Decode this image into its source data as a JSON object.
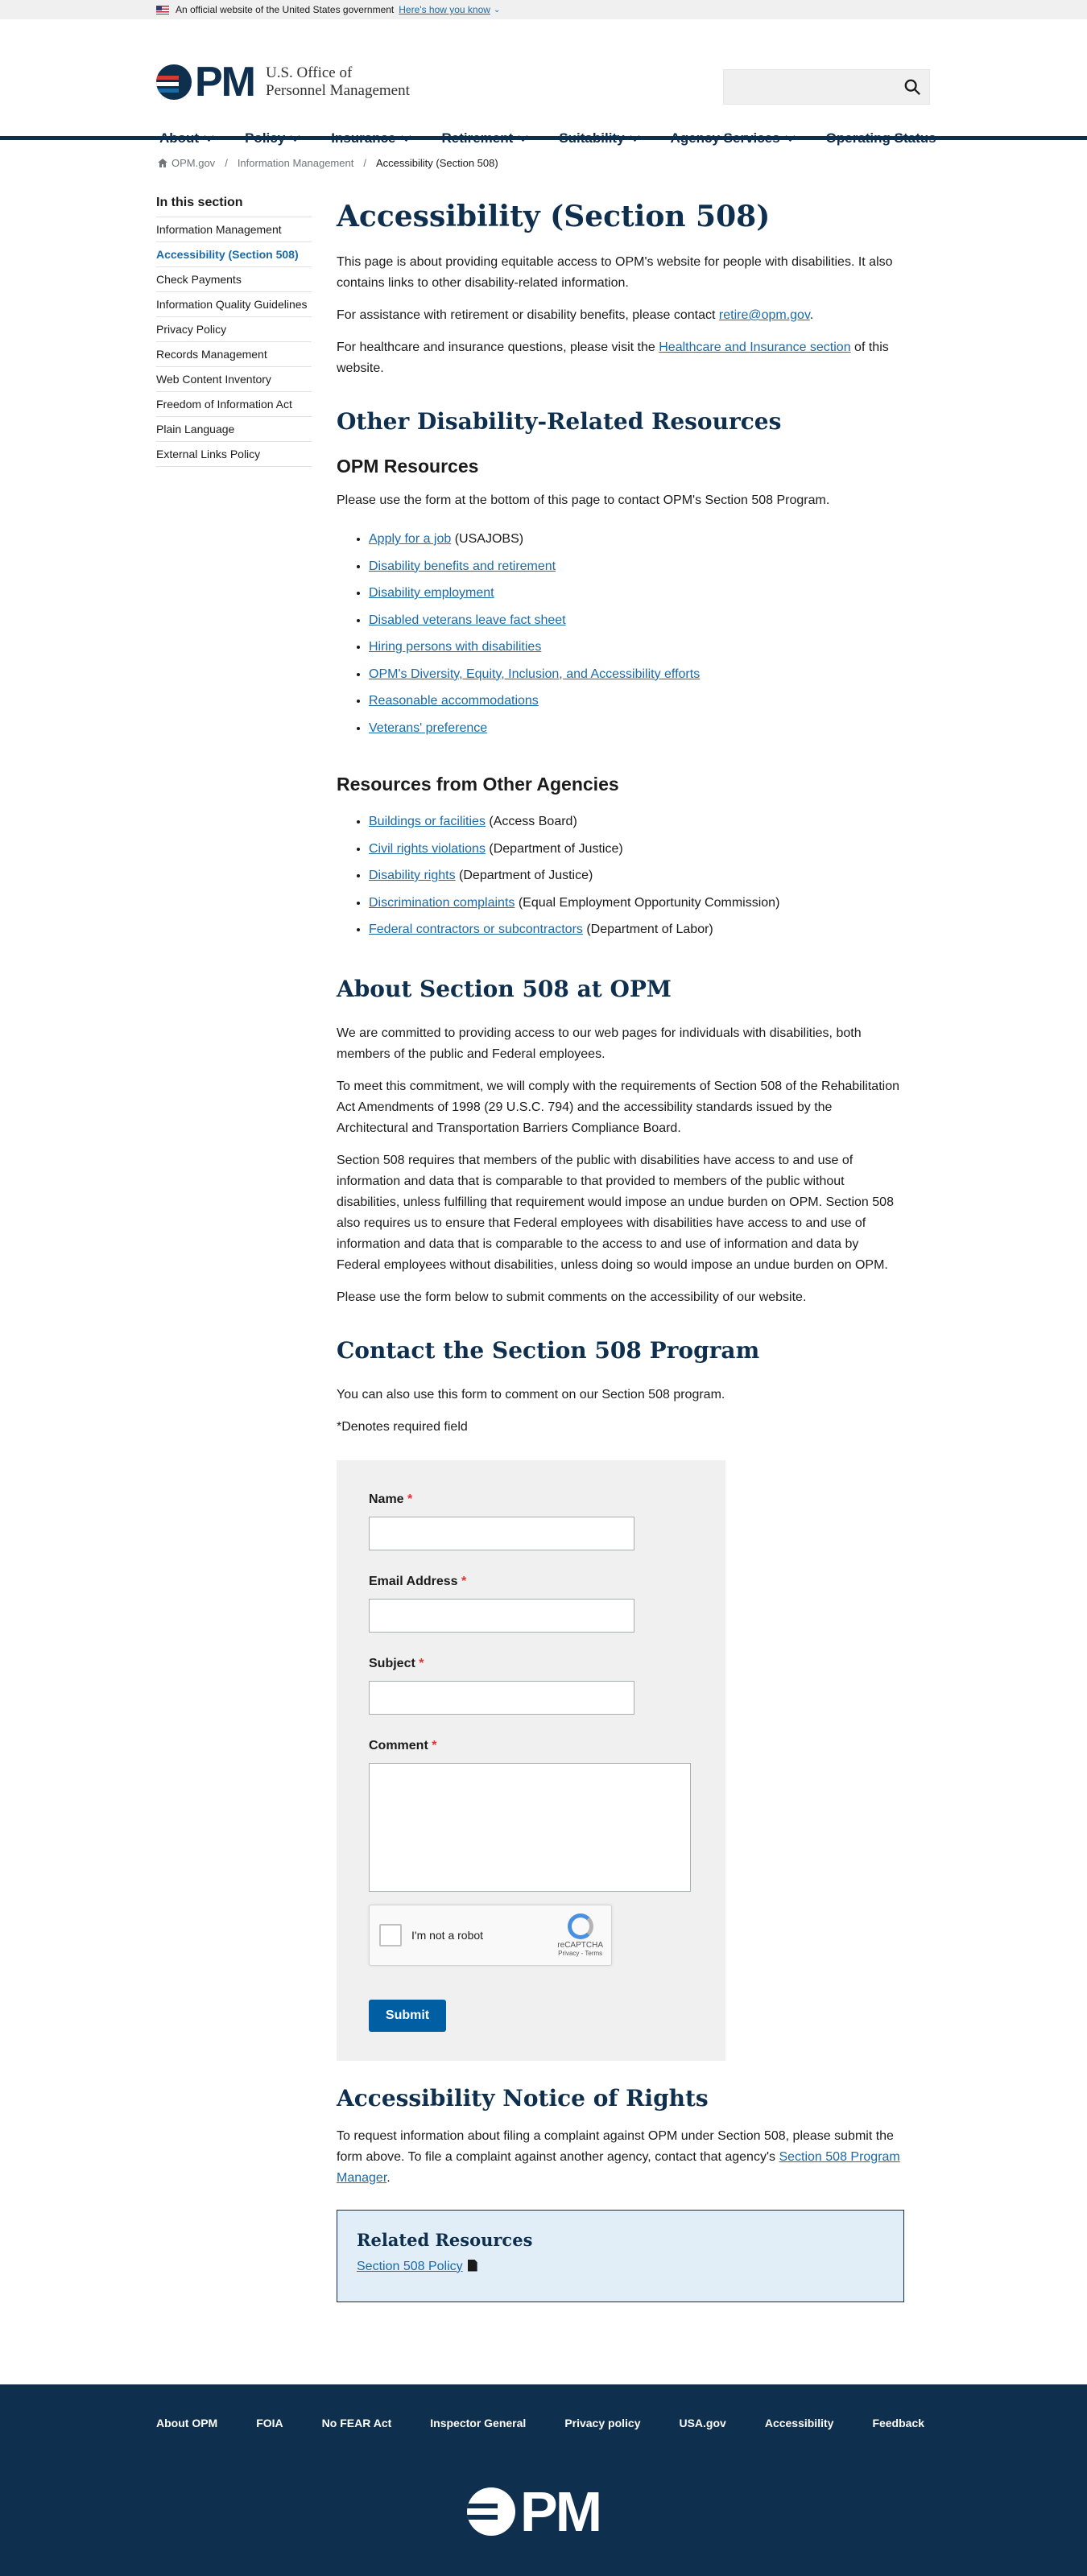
{
  "gov_banner": {
    "text": "An official website of the United States government",
    "link": "Here's how you know"
  },
  "header": {
    "logo_text": "OPM",
    "agency_line1": "U.S. Office of",
    "agency_line2": "Personnel Management"
  },
  "nav": [
    {
      "label": "About"
    },
    {
      "label": "Policy"
    },
    {
      "label": "Insurance"
    },
    {
      "label": "Retirement"
    },
    {
      "label": "Suitability"
    },
    {
      "label": "Agency Services"
    },
    {
      "label": "Operating Status"
    }
  ],
  "breadcrumb": [
    "OPM.gov",
    "Information Management",
    "Accessibility (Section 508)"
  ],
  "sidebar": {
    "title": "In this section",
    "items": [
      "Information Management",
      "Accessibility (Section 508)",
      "Check Payments",
      "Information Quality Guidelines",
      "Privacy Policy",
      "Records Management",
      "Web Content Inventory",
      "Freedom of Information Act",
      "Plain Language",
      "External Links Policy"
    ]
  },
  "main": {
    "title": "Accessibility (Section 508)",
    "intro": "This page is about providing equitable access to OPM's website for people with disabilities. It also contains links to other disability-related information.",
    "assist_pre": "For assistance with retirement or disability benefits, please contact ",
    "assist_link": "retire@opm.gov",
    "assist_post": ".",
    "health_pre": "For healthcare and insurance questions, please visit the ",
    "health_link": "Healthcare and Insurance section",
    "health_post": " of this website.",
    "other_heading": "Other Disability-Related Resources",
    "opm_res_heading": "OPM Resources",
    "opm_res_text": "Please use the form at the bottom of this page to contact OPM's Section 508 Program.",
    "opm_links": [
      {
        "link": "Apply for a job",
        "suffix": " (USAJOBS)"
      },
      {
        "link": "Disability benefits and retirement",
        "suffix": ""
      },
      {
        "link": "Disability employment",
        "suffix": ""
      },
      {
        "link": "Disabled veterans leave fact sheet",
        "suffix": ""
      },
      {
        "link": "Hiring persons with disabilities",
        "suffix": ""
      },
      {
        "link": "OPM's Diversity, Equity, Inclusion, and Accessibility efforts",
        "suffix": ""
      },
      {
        "link": "Reasonable accommodations",
        "suffix": ""
      },
      {
        "link": "Veterans' preference",
        "suffix": ""
      }
    ],
    "other_agencies_heading": "Resources from Other Agencies",
    "agency_links": [
      {
        "link": "Buildings or facilities",
        "suffix": " (Access Board)"
      },
      {
        "link": "Civil rights violations",
        "suffix": " (Department of Justice)"
      },
      {
        "link": "Disability rights",
        "suffix": " (Department of Justice)"
      },
      {
        "link": "Discrimination complaints",
        "suffix": " (Equal Employment Opportunity Commission)"
      },
      {
        "link": "Federal contractors or subcontractors",
        "suffix": " (Department of Labor)"
      }
    ],
    "about_heading": "About Section 508 at OPM",
    "about_p1": "We are committed to providing access to our web pages for individuals with disabilities, both members of the public and Federal employees.",
    "about_p2": "To meet this commitment, we will comply with the requirements of Section 508 of the Rehabilitation Act Amendments of 1998 (29 U.S.C. 794) and the accessibility standards issued by the Architectural and Transportation Barriers Compliance Board.",
    "about_p3": "Section 508 requires that members of the public with disabilities have access to and use of information and data that is comparable to that provided to members of the public without disabilities, unless fulfilling that requirement would impose an undue burden on OPM. Section 508 also requires us to ensure that Federal employees with disabilities have access to and use of information and data that is comparable to the access to and use of information and data by Federal employees without disabilities, unless doing so would impose an undue burden on OPM.",
    "about_p4": "Please use the form below to submit comments on the accessibility of our website.",
    "contact_heading": "Contact the Section 508 Program",
    "contact_p1": "You can also use this form to comment on our Section 508 program.",
    "contact_p2": "*Denotes required field",
    "form": {
      "name_label": "Name",
      "email_label": "Email Address",
      "subject_label": "Subject",
      "comment_label": "Comment",
      "required_mark": "*",
      "captcha_label": "I'm not a robot",
      "captcha_brand": "reCAPTCHA",
      "captcha_terms": "Privacy - Terms",
      "submit_label": "Submit"
    },
    "notice_heading": "Accessibility Notice of Rights",
    "notice_pre": "To request information about filing a complaint against OPM under Section 508, please submit the form above. To file a complaint against another agency, contact that agency's ",
    "notice_link": "Section 508 Program Manager",
    "notice_post": ".",
    "related_heading": "Related Resources",
    "related_link": "Section 508 Policy"
  },
  "footer": {
    "links": [
      "About OPM",
      "FOIA",
      "No FEAR Act",
      "Inspector General",
      "Privacy policy",
      "USA.gov",
      "Accessibility",
      "Feedback"
    ],
    "logo_text": "OPM"
  }
}
